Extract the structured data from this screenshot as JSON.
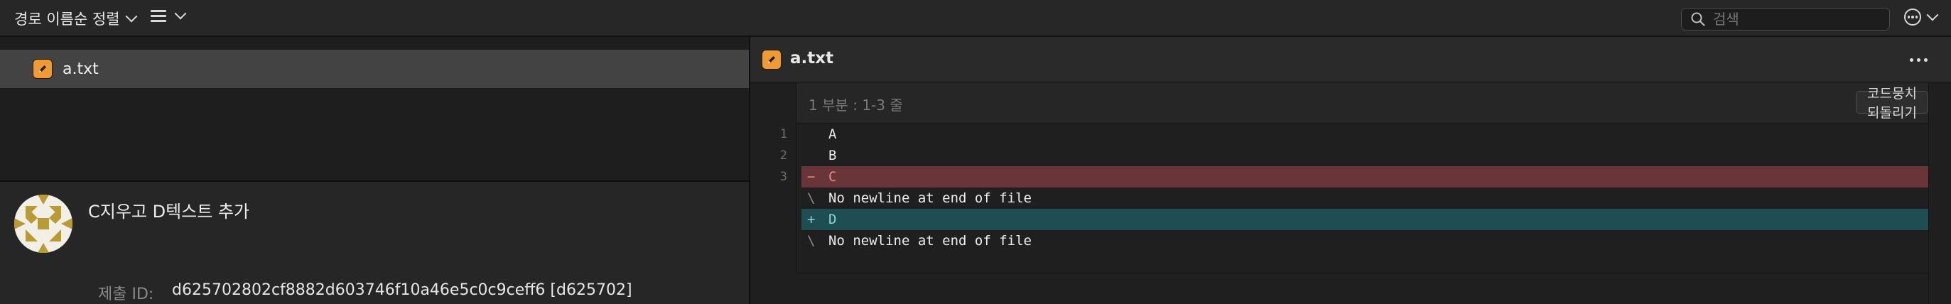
{
  "toolbar": {
    "sort_label": "경로 이름순 정렬",
    "search_placeholder": "검색"
  },
  "sidebar": {
    "files": [
      {
        "name": "a.txt"
      }
    ]
  },
  "commit": {
    "title": "C지우고 D텍스트 추가",
    "id_label": "제출 ID:",
    "id_value": "d625702802cf8882d603746f10a46e5c0c9ceff6 [d625702]"
  },
  "diff": {
    "file_title": "a.txt",
    "hunk_label": "1 부분 : 1-3 줄",
    "discard_label": "코드뭉치 되돌리기",
    "lines": [
      {
        "num": "1",
        "marker": "",
        "text": "A"
      },
      {
        "num": "2",
        "marker": "",
        "text": "B"
      },
      {
        "num": "3",
        "marker": "−",
        "text": "C"
      },
      {
        "num": "",
        "marker": "\\",
        "text": "No newline at end of file"
      },
      {
        "num": "",
        "marker": "+",
        "text": "D"
      },
      {
        "num": "",
        "marker": "\\",
        "text": "No newline at end of file"
      }
    ]
  },
  "colors": {
    "accent_file_icon": "#f09a34",
    "deleted_line_bg": "#6a3538",
    "added_line_bg": "#1f4e52"
  }
}
